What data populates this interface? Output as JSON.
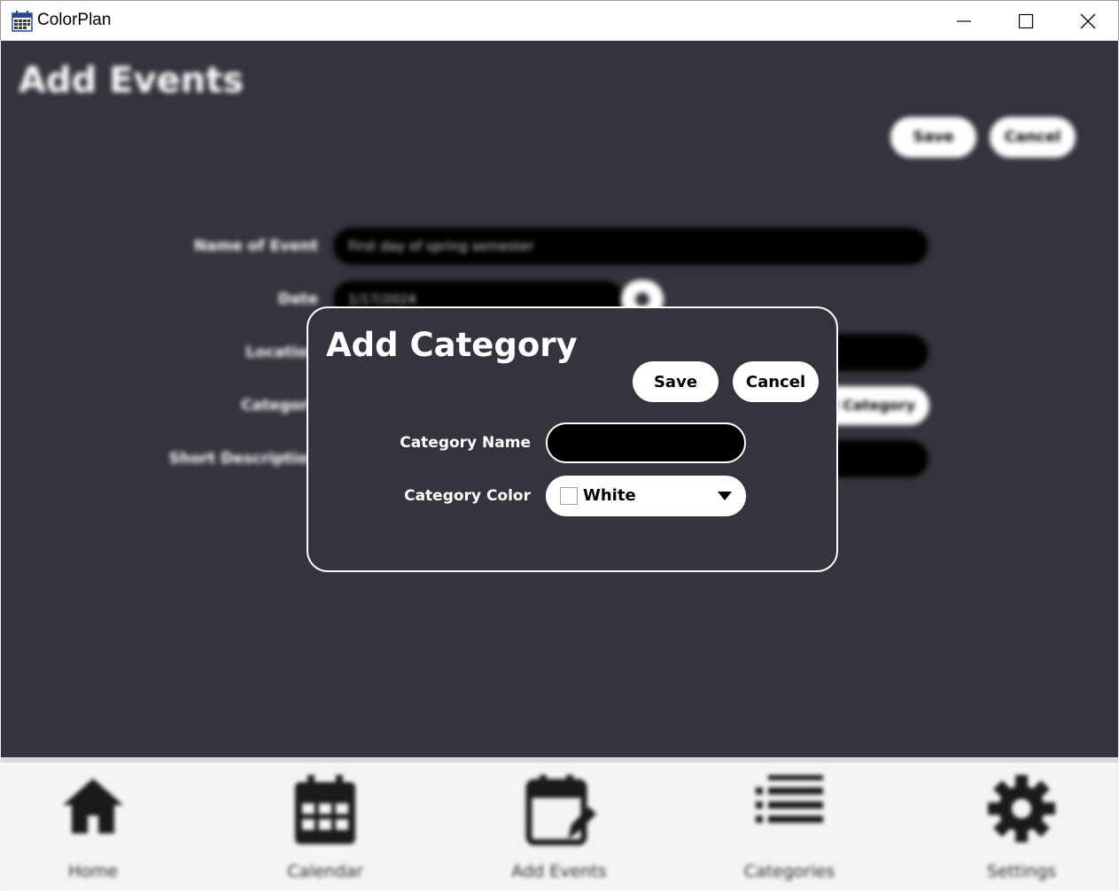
{
  "window": {
    "title": "ColorPlan",
    "icon": "calendar-app-icon",
    "controls": [
      "minimize-icon",
      "maximize-icon",
      "close-icon"
    ]
  },
  "page": {
    "title": "Add Events",
    "save_label": "Save",
    "cancel_label": "Cancel",
    "fields": {
      "name_label": "Name of Event",
      "name_value": "First day of spring semester",
      "date_label": "Date",
      "date_value": "1/17/2024",
      "location_label": "Location",
      "category_label": "Category",
      "category_button": "Add Category",
      "description_label": "Short Description"
    }
  },
  "dialog": {
    "title": "Add Category",
    "save_label": "Save",
    "cancel_label": "Cancel",
    "name_label": "Category Name",
    "name_value": "",
    "color_label": "Category Color",
    "color_value": "White",
    "color_swatch": "#ffffff"
  },
  "nav": {
    "items": [
      {
        "label": "Home",
        "icon": "home-icon"
      },
      {
        "label": "Calendar",
        "icon": "calendar-icon"
      },
      {
        "label": "Add Events",
        "icon": "calendar-edit-icon"
      },
      {
        "label": "Categories",
        "icon": "list-icon"
      },
      {
        "label": "Settings",
        "icon": "gear-icon"
      }
    ]
  },
  "colors": {
    "background": "#34343e",
    "dialog_border": "#ffffff",
    "field": "#000000",
    "nav_background": "#f4f4f4"
  }
}
